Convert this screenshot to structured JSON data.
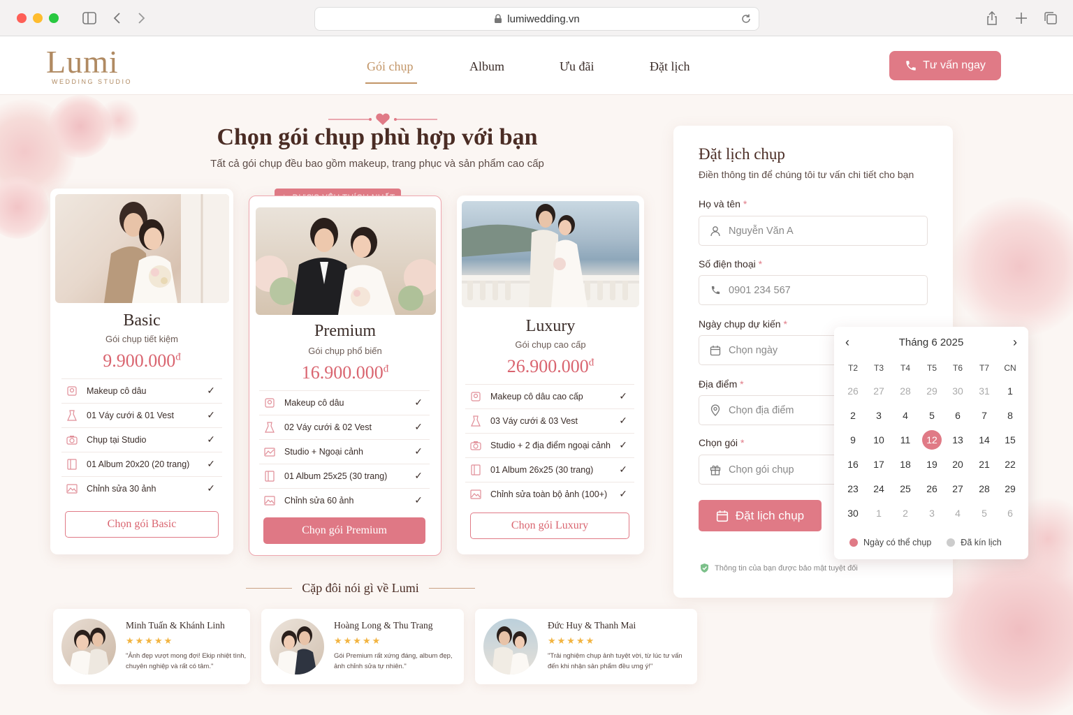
{
  "browser": {
    "url": "lumiwedding.vn"
  },
  "nav": {
    "logo_main": "Lumi",
    "logo_sub": "WEDDING STUDIO",
    "links": [
      "Gói chụp",
      "Album",
      "Ưu đãi",
      "Đặt lịch"
    ],
    "cta": "Tư vấn ngay"
  },
  "hero": {
    "title": "Chọn gói chụp phù hợp với bạn",
    "subtitle": "Tất cả gói chụp đều bao gồm makeup, trang phục và sản phẩm cao cấp"
  },
  "packages": [
    {
      "name": "Basic",
      "tagline": "Gói chụp tiết kiệm",
      "price": "9.900.000",
      "currency": "đ",
      "features": [
        "Makeup cô dâu",
        "01 Váy cưới & 01 Vest",
        "Chụp tại Studio",
        "01 Album 20x20 (20 trang)",
        "Chỉnh sửa 30 ảnh"
      ],
      "button": "Chọn gói Basic"
    },
    {
      "name": "Premium",
      "tagline": "Gói chụp phổ biến",
      "price": "16.900.000",
      "currency": "đ",
      "badge": "ĐƯỢC YÊU THÍCH NHẤT",
      "features": [
        "Makeup cô dâu",
        "02 Váy cưới & 02 Vest",
        "Studio + Ngoại cảnh",
        "01 Album 25x25 (30 trang)",
        "Chỉnh sửa 60 ảnh"
      ],
      "button": "Chọn gói Premium"
    },
    {
      "name": "Luxury",
      "tagline": "Gói chụp cao cấp",
      "price": "26.900.000",
      "currency": "đ",
      "features": [
        "Makeup cô dâu cao cấp",
        "03 Váy cưới & 03 Vest",
        "Studio + 2 địa điểm ngoại cảnh",
        "01 Album 26x25 (30 trang)",
        "Chỉnh sửa toàn bộ ảnh (100+)"
      ],
      "button": "Chọn gói Luxury"
    }
  ],
  "booking": {
    "title": "Đặt lịch chụp",
    "subtitle": "Điền thông tin để chúng tôi tư vấn chi tiết cho bạn",
    "fields": [
      {
        "label": "Họ và tên",
        "required": "*",
        "placeholder": "Nguyễn Văn A",
        "icon": "user-icon"
      },
      {
        "label": "Số điện thoại",
        "required": "*",
        "placeholder": "0901 234 567",
        "icon": "phone-icon"
      },
      {
        "label": "Ngày chụp dự kiến",
        "required": "*",
        "placeholder": "Chọn ngày",
        "icon": "calendar-icon"
      },
      {
        "label": "Địa điểm",
        "required": "*",
        "placeholder": "Chọn địa điểm",
        "icon": "location-icon"
      },
      {
        "label": "Chọn gói",
        "required": "*",
        "placeholder": "Chọn gói chụp",
        "icon": "gift-icon"
      }
    ],
    "submit": "Đặt lịch chụp",
    "privacy": "Thông tin của bạn được bảo mật tuyệt đối"
  },
  "calendar": {
    "month_label": "Tháng 6 2025",
    "weekdays": [
      "T2",
      "T3",
      "T4",
      "T5",
      "T6",
      "T7",
      "CN"
    ],
    "days": [
      "26",
      "27",
      "28",
      "29",
      "30",
      "31",
      "1",
      "2",
      "3",
      "4",
      "5",
      "6",
      "7",
      "8",
      "9",
      "10",
      "11",
      "12",
      "13",
      "14",
      "15",
      "16",
      "17",
      "18",
      "19",
      "20",
      "21",
      "22",
      "23",
      "24",
      "25",
      "26",
      "27",
      "28",
      "29",
      "30",
      "1",
      "2",
      "3",
      "4",
      "5",
      "6"
    ],
    "muted_days": [
      0,
      1,
      2,
      3,
      4,
      5,
      36,
      37,
      38,
      39,
      40,
      41
    ],
    "selected_index": 17,
    "legend_available": "Ngày có thể chụp",
    "legend_booked": "Đã kín lịch"
  },
  "testimonials": {
    "heading": "Cặp đôi nói gì về Lumi",
    "items": [
      {
        "name": "Minh Tuấn & Khánh Linh",
        "stars": "★★★★★",
        "quote": "\"Ảnh đẹp vượt mong đợi! Ekip nhiệt tình, chuyên nghiệp và rất có tâm.\""
      },
      {
        "name": "Hoàng Long & Thu Trang",
        "stars": "★★★★★",
        "quote": "Gói Premium rất xứng đáng, album đẹp, ảnh chỉnh sửa tự nhiên.\""
      },
      {
        "name": "Đức Huy & Thanh Mai",
        "stars": "★★★★★",
        "quote": "\"Trải nghiệm chụp ảnh tuyệt vời, từ lúc tư vấn đến khi nhận sản phẩm đều ưng ý!\""
      }
    ]
  },
  "colors": {
    "accent": "#e07a86",
    "gold": "#c29567",
    "price": "#d9646f",
    "text": "#3a2c28"
  }
}
